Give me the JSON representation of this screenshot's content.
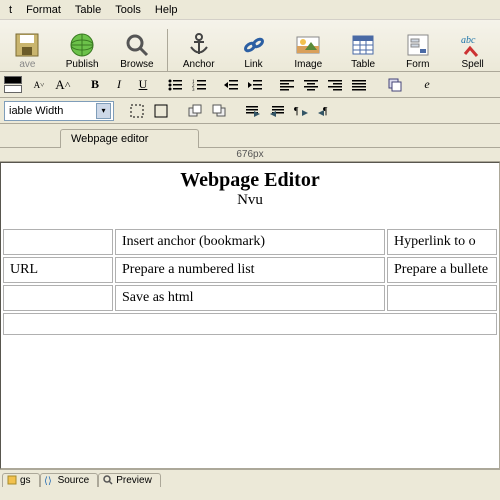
{
  "menubar": {
    "items": [
      "t",
      "Format",
      "Table",
      "Tools",
      "Help"
    ]
  },
  "toolbar": {
    "save": "ave",
    "publish": "Publish",
    "browse": "Browse",
    "anchor": "Anchor",
    "link": "Link",
    "image": "Image",
    "table": "Table",
    "form": "Form",
    "spell": "Spell"
  },
  "format": {
    "font_family": "iable Width"
  },
  "doc_tab": "Webpage editor",
  "ruler_size": "676px",
  "document": {
    "heading": "Webpage Editor",
    "subheading": "Nvu",
    "table": [
      [
        "",
        "Insert anchor (bookmark)",
        "Hyperlink to o"
      ],
      [
        "URL",
        "Prepare a numbered list",
        "Prepare a bullete"
      ],
      [
        "",
        "Save as html",
        ""
      ],
      [
        "",
        "",
        ""
      ]
    ]
  },
  "viewtabs": {
    "t0": "gs",
    "t1": "Source",
    "t2": "Preview"
  }
}
